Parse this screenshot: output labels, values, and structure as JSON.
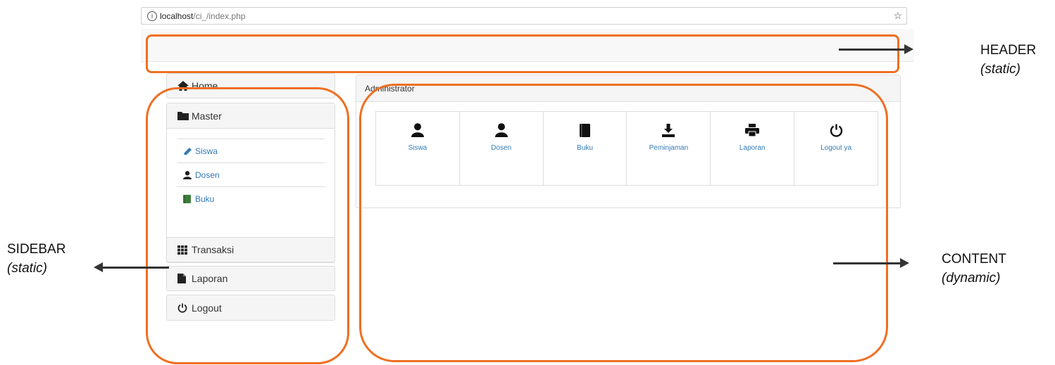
{
  "browser": {
    "url_host": "localhost",
    "url_path": "/ci_/index.php"
  },
  "sidebar": {
    "home": "Home",
    "master": "Master",
    "master_items": [
      {
        "label": "Siswa",
        "icon": "pencil-icon"
      },
      {
        "label": "Dosen",
        "icon": "user-icon"
      },
      {
        "label": "Buku",
        "icon": "book-icon"
      }
    ],
    "transaksi": "Transaksi",
    "laporan": "Laporan",
    "logout": "Logout"
  },
  "content": {
    "heading": "Administrator",
    "tiles": [
      {
        "label": "Siswa",
        "icon": "user-icon"
      },
      {
        "label": "Dosen",
        "icon": "user-icon"
      },
      {
        "label": "Buku",
        "icon": "book-icon"
      },
      {
        "label": "Peminjaman",
        "icon": "download-icon"
      },
      {
        "label": "Laporan",
        "icon": "print-icon"
      },
      {
        "label": "Logout ya",
        "icon": "power-icon"
      }
    ]
  },
  "annotations": {
    "header": "HEADER",
    "header_note": "(static)",
    "sidebar": "SIDEBAR",
    "sidebar_note": "(static)",
    "content": "CONTENT",
    "content_note": "(dynamic)"
  },
  "colors": {
    "outline": "#ef6f22",
    "link": "#337ab7",
    "panel_bg": "#f5f5f5"
  }
}
